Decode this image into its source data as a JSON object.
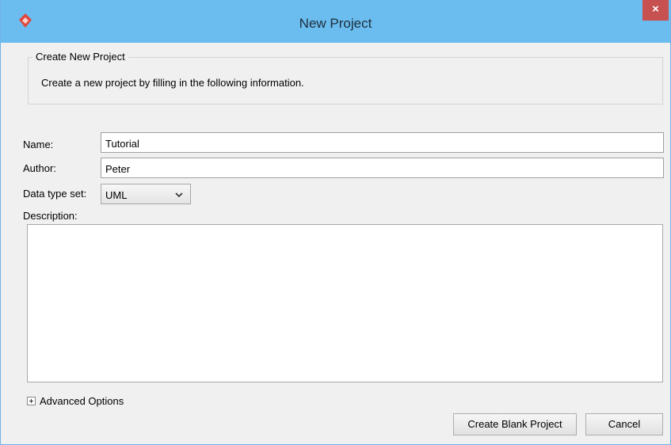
{
  "window": {
    "title": "New Project",
    "close_label": "×"
  },
  "group": {
    "legend": "Create New Project",
    "description": "Create a new project by filling in the following information."
  },
  "form": {
    "name_label": "Name:",
    "name_value": "Tutorial",
    "author_label": "Author:",
    "author_value": "Peter",
    "datatype_label": "Data type set:",
    "datatype_value": "UML",
    "description_label": "Description:",
    "description_value": ""
  },
  "advanced": {
    "label": "Advanced Options"
  },
  "buttons": {
    "create": "Create Blank Project",
    "cancel": "Cancel"
  },
  "colors": {
    "titlebar": "#6bbdf0",
    "close": "#c75050",
    "app_icon": "#e2463a"
  }
}
